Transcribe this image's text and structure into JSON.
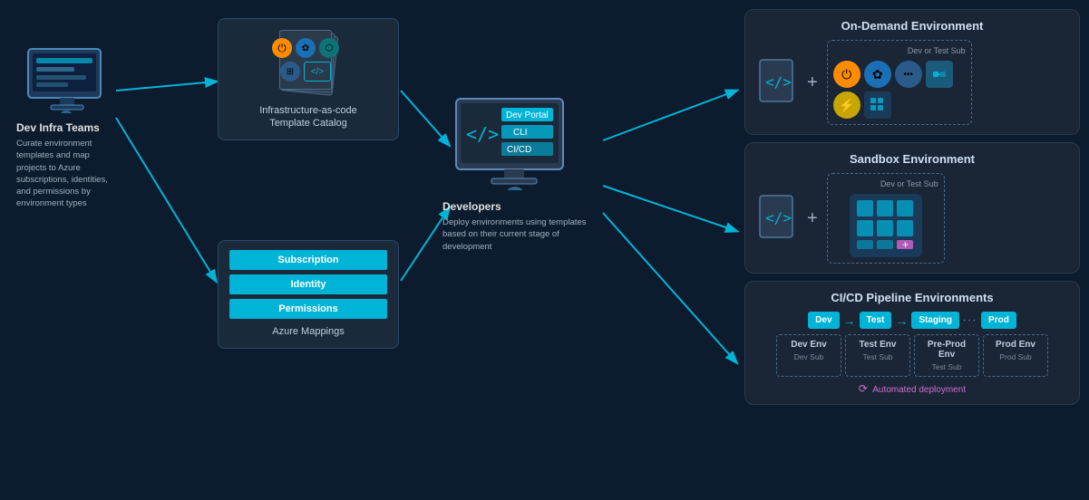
{
  "devInfra": {
    "label": "Dev Infra Teams",
    "desc": "Curate environment templates and map projects to Azure subscriptions, identities, and permissions by environment types"
  },
  "iac": {
    "title_line1": "Infrastructure-as-code",
    "title_line2": "Template Catalog"
  },
  "azure": {
    "rows": [
      "Subscription",
      "Identity",
      "Permissions"
    ],
    "label": "Azure Mappings"
  },
  "developers": {
    "label": "Developers",
    "desc": "Deploy environments using templates based on their current stage of development",
    "menu": [
      "Dev Portal",
      "CLI",
      "CI/CD"
    ]
  },
  "onDemand": {
    "title": "On-Demand Environment",
    "sublabel": "Dev or Test Sub"
  },
  "sandbox": {
    "title": "Sandbox Environment",
    "sublabel": "Dev or Test Sub"
  },
  "cicd": {
    "title": "CI/CD Pipeline Environments",
    "stages": [
      "Dev",
      "Test",
      "Staging",
      "Prod"
    ],
    "envs": [
      {
        "name": "Dev Env",
        "sub": "Dev Sub"
      },
      {
        "name": "Test Env",
        "sub": "Test Sub"
      },
      {
        "name": "Pre-Prod Env",
        "sub": "Test Sub"
      },
      {
        "name": "Prod Env",
        "sub": "Prod Sub"
      }
    ],
    "autoLabel": "Automated deployment"
  },
  "colors": {
    "cyan": "#00b4d8",
    "bg": "#0d1b2e",
    "panel": "#1a2535"
  }
}
